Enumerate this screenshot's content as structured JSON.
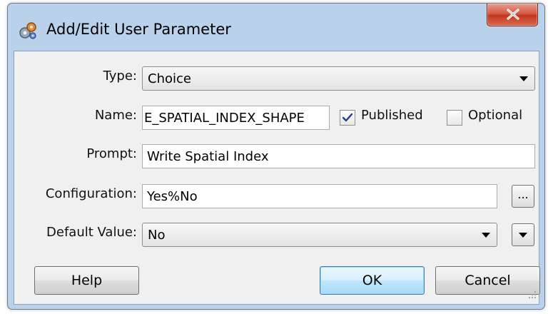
{
  "window": {
    "title": "Add/Edit User Parameter",
    "icon": "gears-icon",
    "close_icon": "close-icon"
  },
  "form": {
    "type": {
      "label": "Type:",
      "value": "Choice"
    },
    "name": {
      "label": "Name:",
      "value": "E_SPATIAL_INDEX_SHAPE"
    },
    "published": {
      "label": "Published",
      "checked": true
    },
    "optional": {
      "label": "Optional",
      "checked": false
    },
    "prompt": {
      "label": "Prompt:",
      "value": "Write Spatial Index"
    },
    "configuration": {
      "label": "Configuration:",
      "value": "Yes%No",
      "browse_label": "..."
    },
    "default_value": {
      "label": "Default Value:",
      "value": "No"
    }
  },
  "buttons": {
    "help": "Help",
    "ok": "OK",
    "cancel": "Cancel"
  },
  "colors": {
    "frame": "#b9d1ea",
    "client": "#f0f0f0",
    "close": "#c2341c",
    "default_button": "#bee6fd"
  }
}
